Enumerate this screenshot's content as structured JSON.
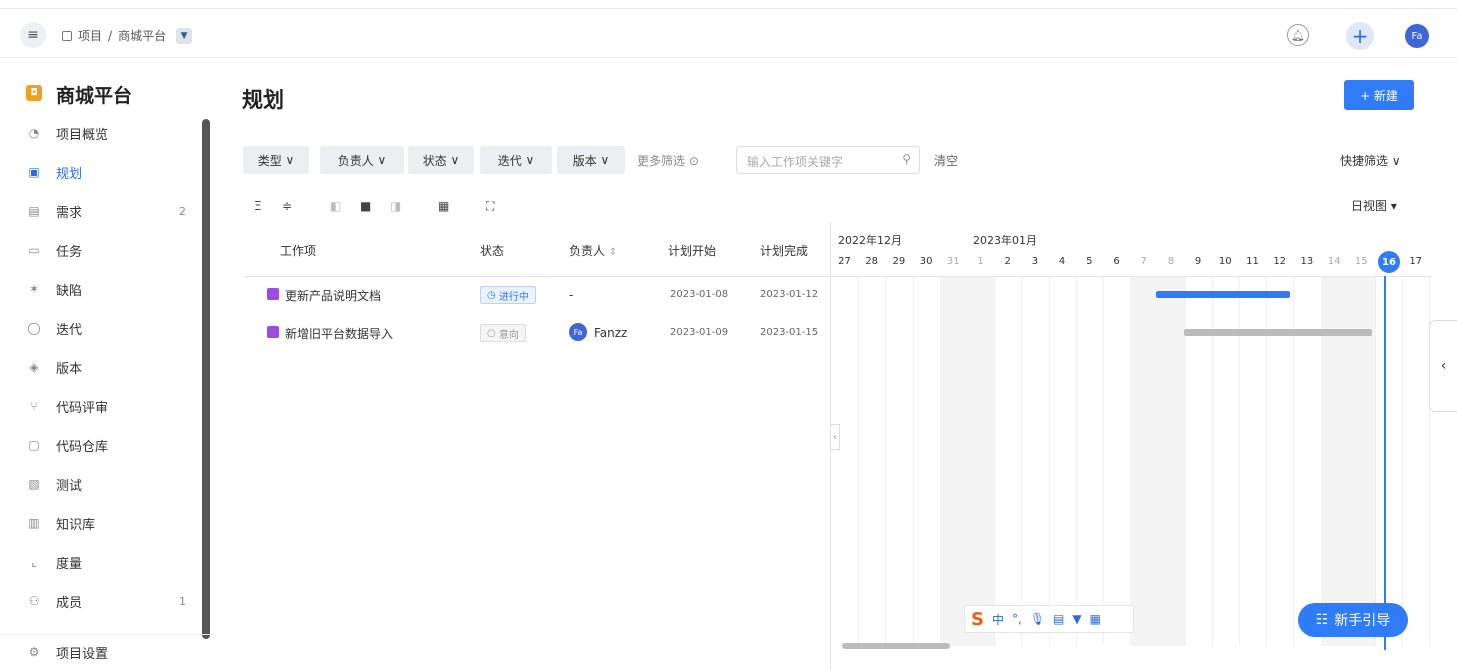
{
  "topbar": {
    "menu_icon": "hamburger-icon",
    "breadcrumb_root": "项目",
    "breadcrumb_sep": "/",
    "breadcrumb_project": "商城平台",
    "avatar_initials": "Fa"
  },
  "sidebar": {
    "project_name": "商城平台",
    "items": [
      {
        "label": "项目概览",
        "icon": "dashboard-icon",
        "count": ""
      },
      {
        "label": "规划",
        "icon": "calendar-icon",
        "count": ""
      },
      {
        "label": "需求",
        "icon": "requirement-icon",
        "count": "2"
      },
      {
        "label": "任务",
        "icon": "task-icon",
        "count": ""
      },
      {
        "label": "缺陷",
        "icon": "bug-icon",
        "count": ""
      },
      {
        "label": "迭代",
        "icon": "iteration-icon",
        "count": ""
      },
      {
        "label": "版本",
        "icon": "version-icon",
        "count": ""
      },
      {
        "label": "代码评审",
        "icon": "merge-icon",
        "count": ""
      },
      {
        "label": "代码仓库",
        "icon": "code-icon",
        "count": ""
      },
      {
        "label": "测试",
        "icon": "test-icon",
        "count": ""
      },
      {
        "label": "知识库",
        "icon": "book-icon",
        "count": ""
      },
      {
        "label": "度量",
        "icon": "chart-icon",
        "count": ""
      },
      {
        "label": "成员",
        "icon": "members-icon",
        "count": "1"
      }
    ],
    "settings_label": "项目设置",
    "active_index": 1
  },
  "main": {
    "title": "规划",
    "new_button": "+ 新建",
    "filters": [
      "类型",
      "负责人",
      "状态",
      "迭代",
      "版本"
    ],
    "more_filters": "更多筛选",
    "search_placeholder": "输入工作项关键字",
    "clear": "清空",
    "quick_filter": "快捷筛选",
    "view_mode": "日视图"
  },
  "table": {
    "headers": {
      "item": "工作项",
      "status": "状态",
      "owner": "负责人",
      "start": "计划开始",
      "end": "计划完成"
    },
    "rows": [
      {
        "title": "更新产品说明文档",
        "status": "进行中",
        "owner": "-",
        "start": "2023-01-08",
        "end": "2023-01-12"
      },
      {
        "title": "新增旧平台数据导入",
        "status": "意向",
        "owner": "Fanzz",
        "owner_initials": "Fa",
        "start": "2023-01-09",
        "end": "2023-01-15"
      }
    ]
  },
  "gantt": {
    "month_dec": "2022年12月",
    "month_jan": "2023年01月",
    "days": [
      "27",
      "28",
      "29",
      "30",
      "31",
      "1",
      "2",
      "3",
      "4",
      "5",
      "6",
      "7",
      "8",
      "9",
      "10",
      "11",
      "12",
      "13",
      "14",
      "15",
      "16",
      "17"
    ],
    "today": "16"
  },
  "ime_bar": {
    "label": "中"
  },
  "guide_button": "新手引导",
  "colors": {
    "accent": "#2f7cf6",
    "project_logo": "#f0a020",
    "item_icon": "#9b4de0"
  }
}
